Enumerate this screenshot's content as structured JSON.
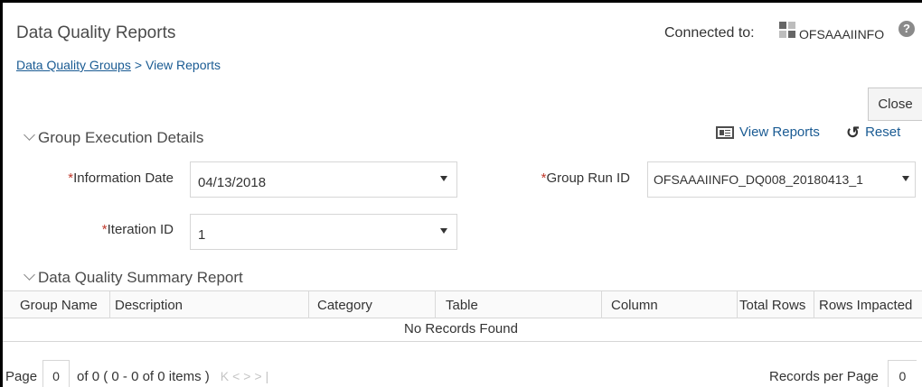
{
  "header": {
    "title": "Data Quality Reports",
    "connected_label": "Connected to:",
    "connection_name": "OFSAAAIINFO",
    "help_icon": "help-icon"
  },
  "breadcrumb": {
    "parent": "Data Quality Groups",
    "separator": ">",
    "current": "View Reports"
  },
  "toolbar": {
    "close_label": "Close"
  },
  "group_section": {
    "title": "Group Execution Details",
    "view_reports_label": "View Reports",
    "reset_label": "Reset",
    "fields": {
      "information_date": {
        "required_mark": "*",
        "label": "Information Date",
        "value": "04/13/2018"
      },
      "group_run_id": {
        "required_mark": "*",
        "label": "Group Run ID",
        "value": "OFSAAAIINFO_DQ008_20180413_1"
      },
      "iteration_id": {
        "required_mark": "*",
        "label": "Iteration ID",
        "value": "1"
      }
    }
  },
  "summary_section": {
    "title": "Data Quality Summary Report",
    "columns": [
      "Group Name",
      "Description",
      "Category",
      "Table",
      "Column",
      "Total Rows",
      "Rows Impacted"
    ],
    "empty_message": "No Records Found"
  },
  "pagination": {
    "page_label": "Page",
    "page_value": "0",
    "page_info": "of 0 ( 0 - 0 of 0 items )",
    "records_per_page_label": "Records per Page",
    "records_per_page_value": "0"
  },
  "colors": {
    "link": "#1a5b93",
    "required": "#c0392b",
    "text": "#333333"
  }
}
